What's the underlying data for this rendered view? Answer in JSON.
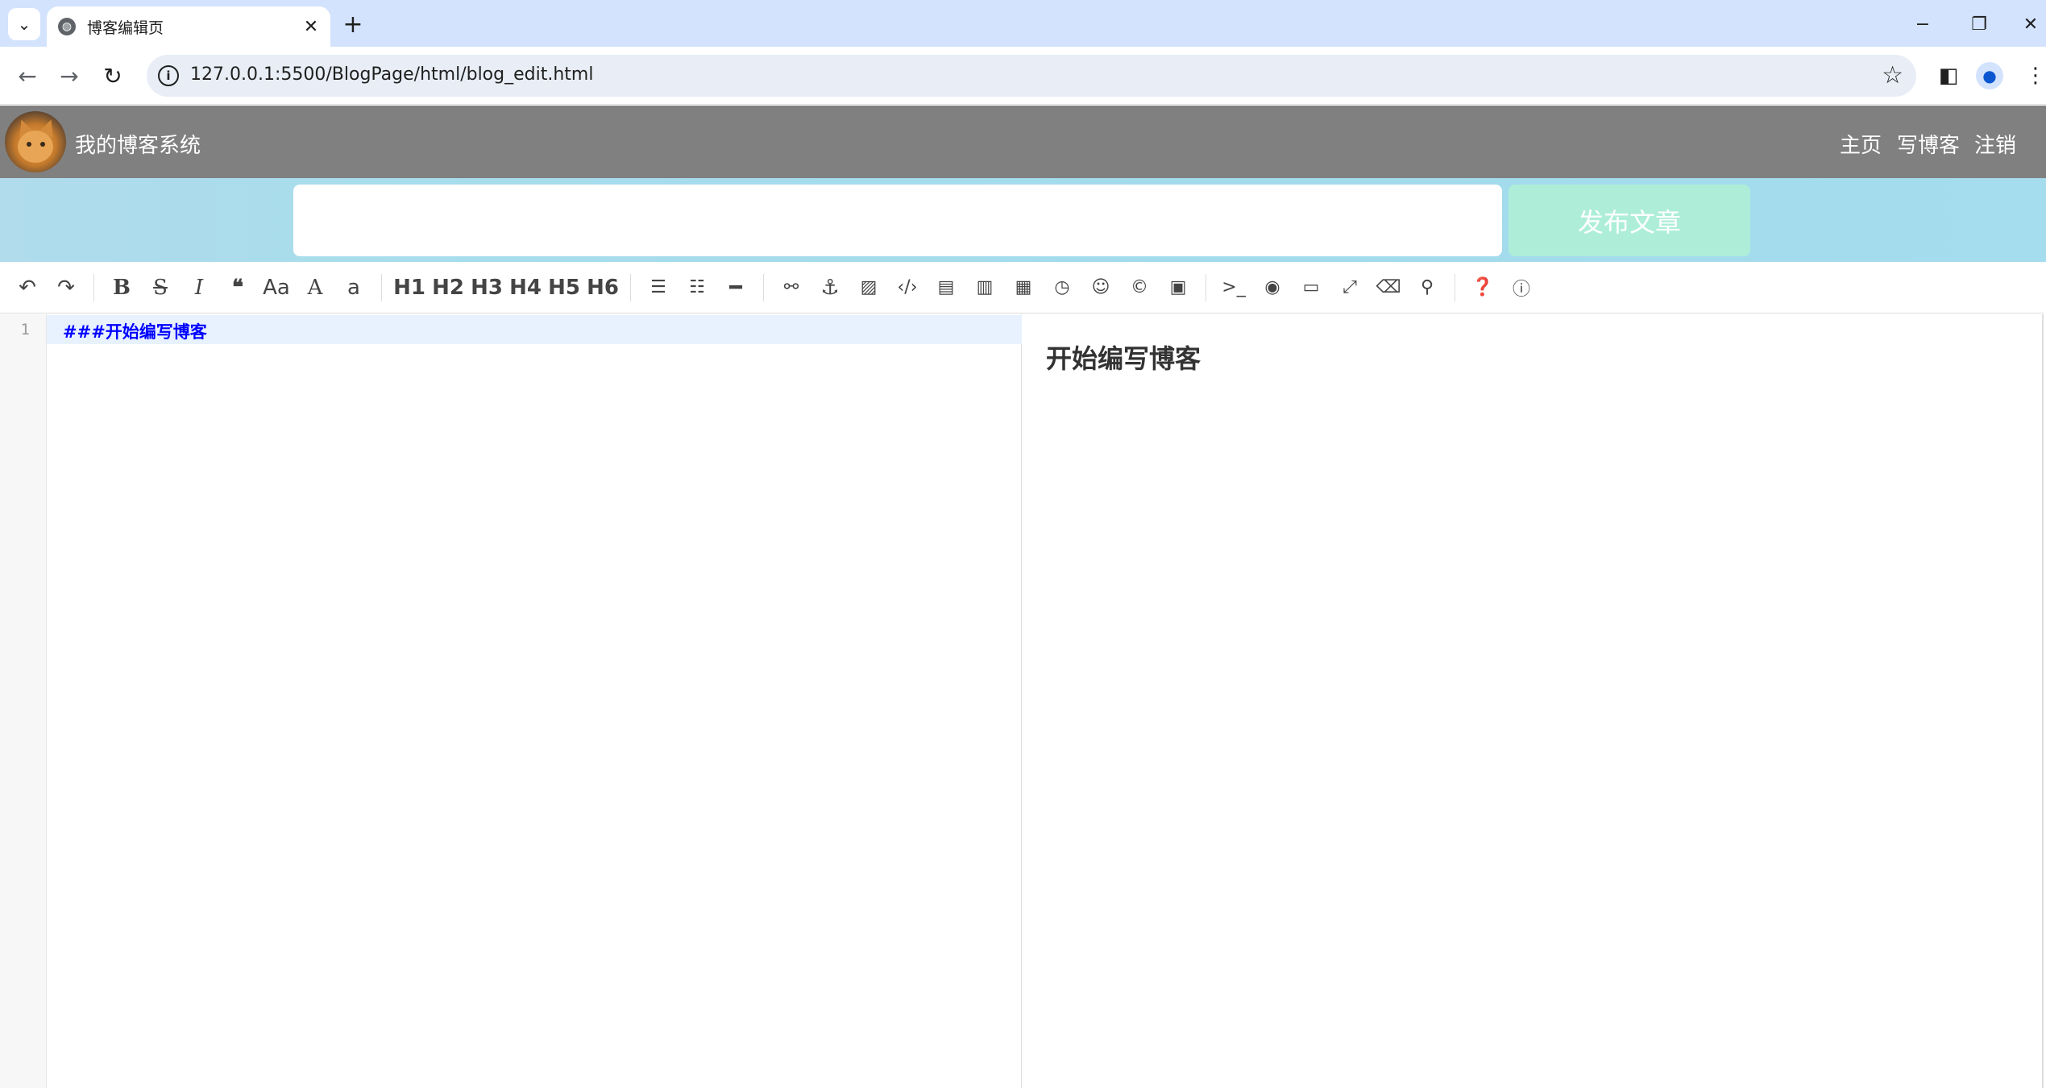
{
  "browser": {
    "tab_title": "博客编辑页",
    "url": "127.0.0.1:5500/BlogPage/html/blog_edit.html"
  },
  "nav": {
    "site_title": "我的博客系统",
    "links": [
      "主页",
      "写博客",
      "注销"
    ]
  },
  "title_bar": {
    "title_value": "",
    "publish_label": "发布文章"
  },
  "toolbar": {
    "headings": [
      "H1",
      "H2",
      "H3",
      "H4",
      "H5",
      "H6"
    ],
    "aa": "Aa",
    "big_a": "A",
    "small_a": "a"
  },
  "editor": {
    "line_number": "1",
    "line_text": "###开始编写博客",
    "preview_heading": "开始编写博客"
  }
}
